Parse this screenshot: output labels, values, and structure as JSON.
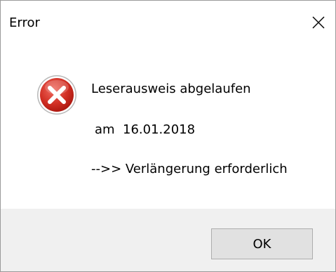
{
  "window": {
    "title": "Error",
    "close_glyph": "✕"
  },
  "icon": {
    "name": "error-icon",
    "color": "#d32f2f"
  },
  "message": {
    "line1": "Leserausweis abgelaufen",
    "line2": "am  16.01.2018",
    "line3": "-->> Verlängerung erforderlich"
  },
  "buttons": {
    "ok_label": "OK"
  }
}
